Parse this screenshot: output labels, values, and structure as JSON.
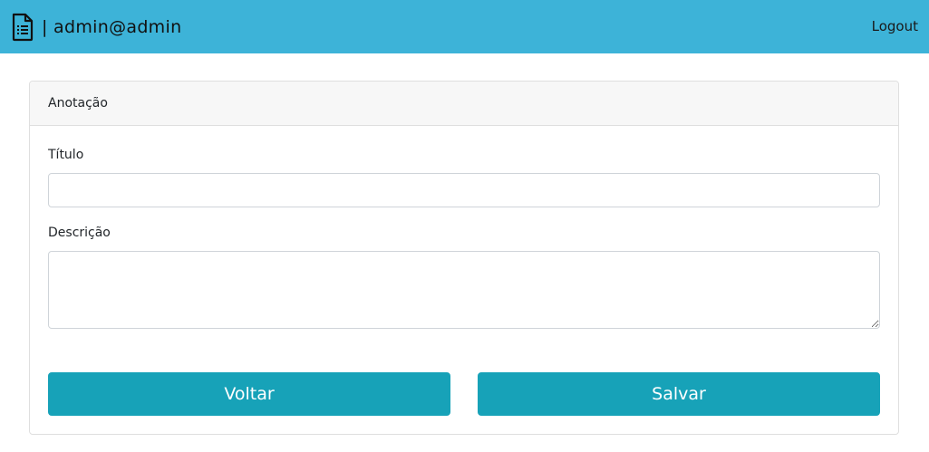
{
  "navbar": {
    "brand_icon": "document-icon",
    "brand_text": "| admin@admin",
    "logout_label": "Logout",
    "color": "#3db3d8"
  },
  "card": {
    "header": "Anotação",
    "titulo_label": "Título",
    "titulo_value": "",
    "descricao_label": "Descrição",
    "descricao_value": "",
    "back_label": "Voltar",
    "save_label": "Salvar",
    "button_color": "#17a2b8"
  }
}
